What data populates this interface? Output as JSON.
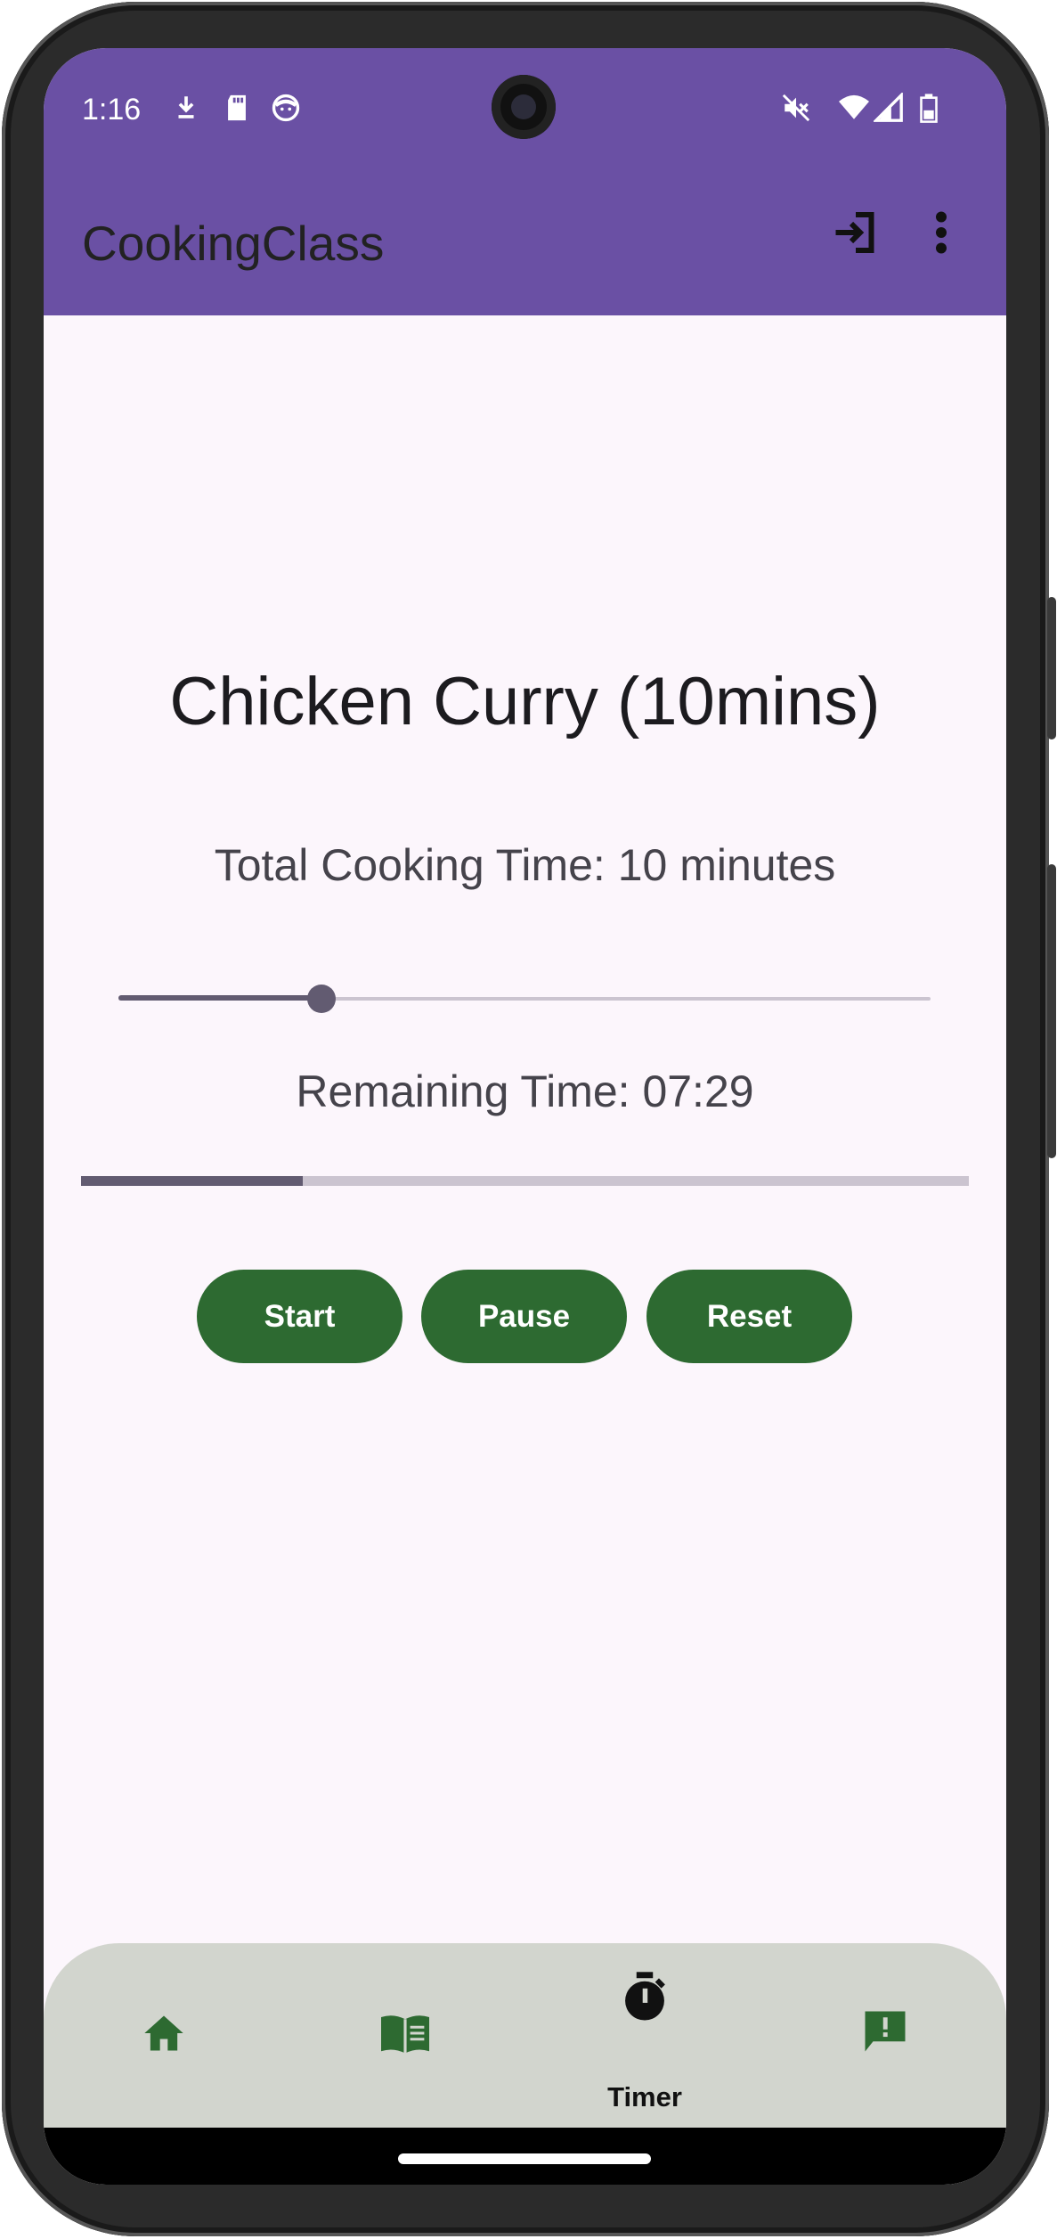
{
  "status_bar": {
    "time": "1:16",
    "icons": [
      "download-icon",
      "sd-card-icon",
      "face-icon",
      "mute-icon",
      "wifi-icon",
      "signal-icon",
      "battery-icon"
    ]
  },
  "app_bar": {
    "title": "CookingClass",
    "actions": [
      "login-icon",
      "more-vert-icon"
    ],
    "color": "#6a50a4"
  },
  "timer": {
    "recipe_title": "Chicken Curry (10mins)",
    "total_time_label": "Total Cooking Time: 10 minutes",
    "slider_fraction": 0.25,
    "remaining_label": "Remaining Time: 07:29",
    "progress_fraction": 0.25
  },
  "buttons": {
    "start": "Start",
    "pause": "Pause",
    "reset": "Reset",
    "color": "#2d6a31"
  },
  "bottom_nav": {
    "items": [
      {
        "icon": "home-icon",
        "label": ""
      },
      {
        "icon": "book-icon",
        "label": ""
      },
      {
        "icon": "timer-icon",
        "label": "Timer"
      },
      {
        "icon": "feedback-icon",
        "label": ""
      }
    ],
    "selected": "Timer",
    "icon_color": "#2d6a31"
  }
}
